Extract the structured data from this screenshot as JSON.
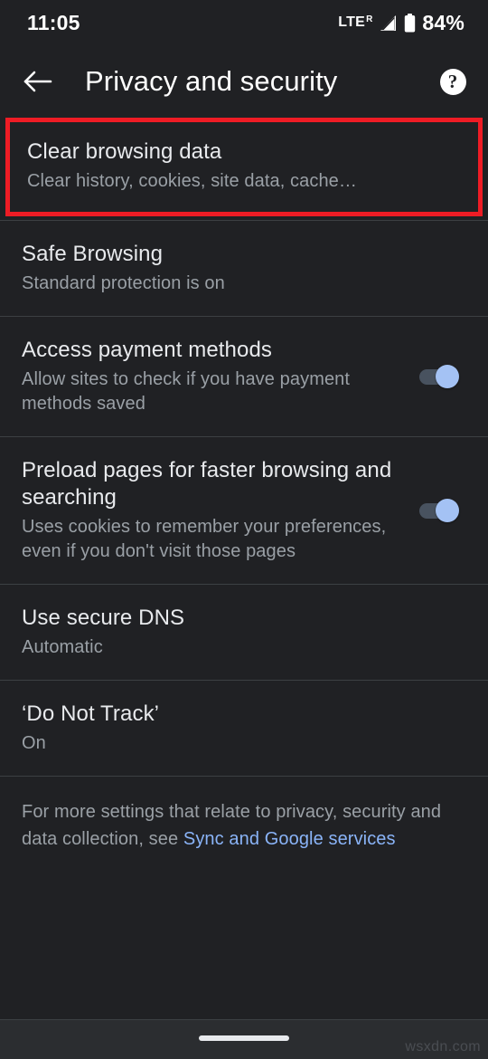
{
  "status_bar": {
    "clock": "11:05",
    "network_label": "LTE",
    "network_sup": "R",
    "battery_percent": "84%",
    "signal_icon": "signal-triangle-icon",
    "battery_icon": "battery-icon"
  },
  "app_bar": {
    "back_icon": "back-arrow-icon",
    "title": "Privacy and security",
    "help_icon": "help-question-icon",
    "help_glyph": "?"
  },
  "highlight": {
    "color": "#ee1c25"
  },
  "settings": [
    {
      "title": "Clear browsing data",
      "subtitle": "Clear history, cookies, site data, cache…",
      "toggle": null,
      "highlighted": true
    },
    {
      "title": "Safe Browsing",
      "subtitle": "Standard protection is on",
      "toggle": null,
      "highlighted": false
    },
    {
      "title": "Access payment methods",
      "subtitle": "Allow sites to check if you have payment methods saved",
      "toggle": "on",
      "highlighted": false
    },
    {
      "title": "Preload pages for faster browsing and searching",
      "subtitle": "Uses cookies to remember your preferences, even if you don't visit those pages",
      "toggle": "on",
      "highlighted": false
    },
    {
      "title": "Use secure DNS",
      "subtitle": "Automatic",
      "toggle": null,
      "highlighted": false
    },
    {
      "title": "‘Do Not Track’",
      "subtitle": "On",
      "toggle": null,
      "highlighted": false
    }
  ],
  "footer": {
    "text_before": "For more settings that relate to privacy, security and data collection, see ",
    "link_text": "Sync and Google services",
    "link_color": "#8ab4f8"
  },
  "nav_bar": {
    "gesture_pill": "home-gesture-pill"
  },
  "watermark": {
    "text": "wsxdn.com"
  },
  "theme": {
    "background": "#202124",
    "title_color": "#e8eaed",
    "subtitle_color": "#9aa0a6",
    "divider_color": "#3c4043",
    "toggle_track": "#48525f",
    "toggle_thumb": "#a4c2f4"
  }
}
